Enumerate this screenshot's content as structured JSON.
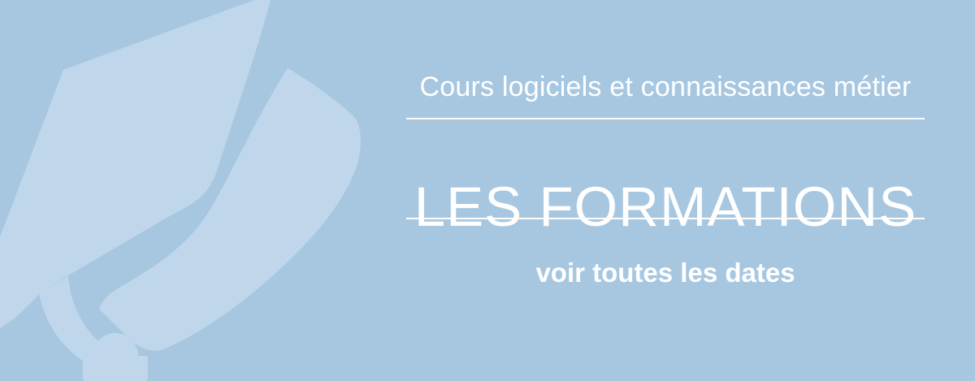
{
  "banner": {
    "subtitle": "Cours logiciels et connaissances métier",
    "title": "LES FORMATIONS",
    "cta_label": "voir toutes les dates"
  },
  "icons": {
    "background": "graduation-cap-icon"
  },
  "colors": {
    "background": "#a7c7e1",
    "graphic": "#c0d7eb",
    "text": "#ffffff"
  }
}
